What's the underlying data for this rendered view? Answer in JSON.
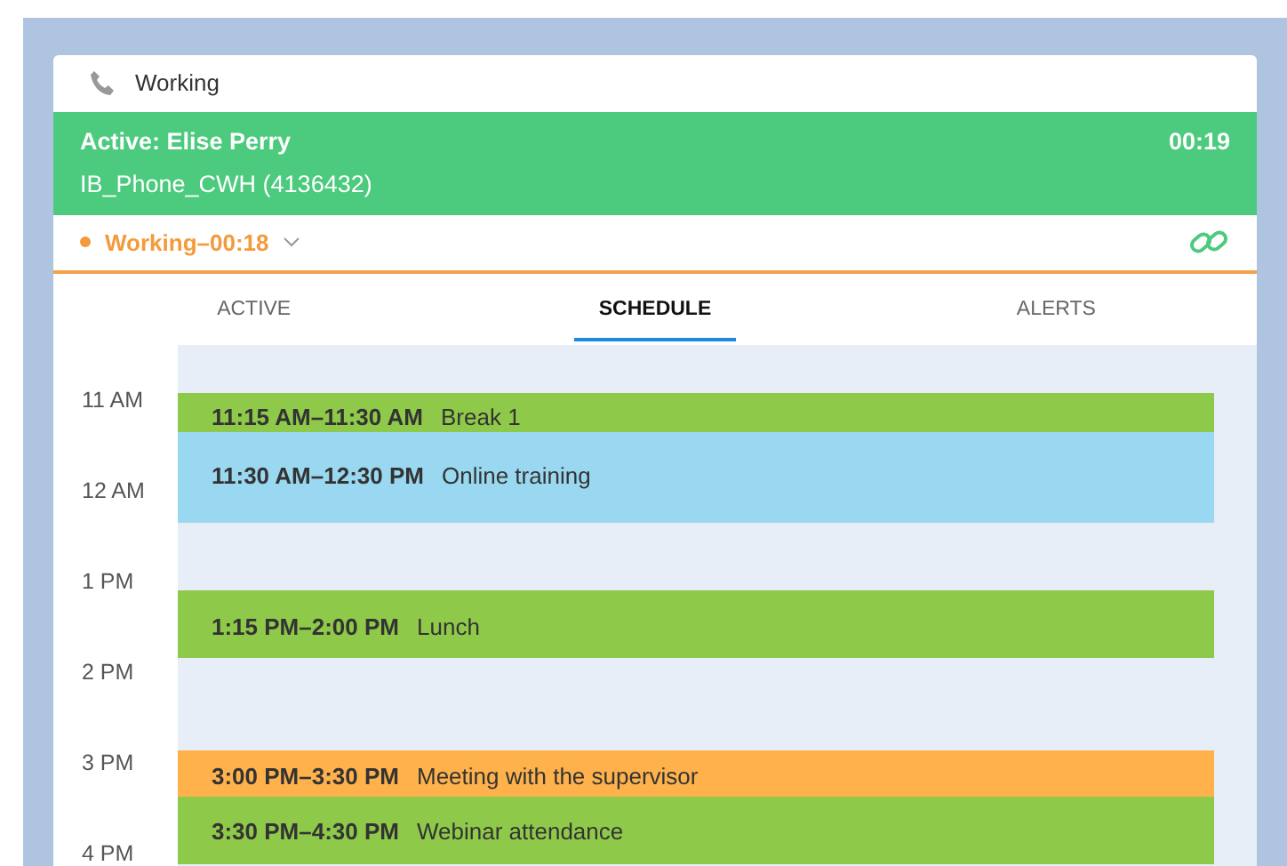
{
  "header": {
    "title": "Working"
  },
  "active_call": {
    "label": "Active: Elise Perry",
    "line": "IB_Phone_CWH (4136432)",
    "timer": "00:19"
  },
  "status": {
    "text": "Working–00:18"
  },
  "tabs": [
    {
      "label": "ACTIVE",
      "selected": false
    },
    {
      "label": "SCHEDULE",
      "selected": true
    },
    {
      "label": "ALERTS",
      "selected": false
    }
  ],
  "hours": [
    "11 AM",
    "12 AM",
    "1 PM",
    "2 PM",
    "3 PM",
    "4 PM"
  ],
  "events": [
    {
      "time": "11:15 AM–11:30 AM",
      "title": "Break 1",
      "color": "#8fc94a"
    },
    {
      "time": "11:30 AM–12:30 PM",
      "title": "Online training",
      "color": "#99d8f0"
    },
    {
      "time": "1:15 PM–2:00 PM",
      "title": "Lunch",
      "color": "#8fc94a"
    },
    {
      "time": "3:00 PM–3:30 PM",
      "title": "Meeting with the supervisor",
      "color": "#ffb24c"
    },
    {
      "time": "3:30 PM–4:30 PM",
      "title": "Webinar attendance",
      "color": "#8fc94a"
    }
  ]
}
